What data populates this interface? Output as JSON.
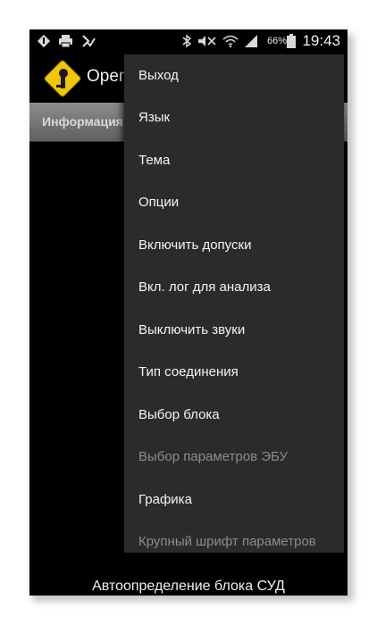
{
  "status_bar": {
    "battery_percent": "66%",
    "time": "19:43"
  },
  "app": {
    "title": "Open"
  },
  "tabs": {
    "info_label": "Информация"
  },
  "menu": {
    "items": [
      {
        "label": "Выход",
        "enabled": true
      },
      {
        "label": "Язык",
        "enabled": true
      },
      {
        "label": "Тема",
        "enabled": true
      },
      {
        "label": "Опции",
        "enabled": true
      },
      {
        "label": "Включить допуски",
        "enabled": true
      },
      {
        "label": "Вкл. лог для анализа",
        "enabled": true
      },
      {
        "label": "Выключить звуки",
        "enabled": true
      },
      {
        "label": "Тип соединения",
        "enabled": true
      },
      {
        "label": "Выбор блока",
        "enabled": true
      },
      {
        "label": "Выбор параметров ЭБУ",
        "enabled": false
      },
      {
        "label": "Графика",
        "enabled": true
      },
      {
        "label": "Крупный шрифт параметров",
        "enabled": false
      }
    ]
  },
  "footer": {
    "label": "Автоопределение блока СУД"
  },
  "colors": {
    "menu_background": "#2b2b2b",
    "logo_yellow": "#f2c50d",
    "disabled_text": "#8c8c8c"
  }
}
